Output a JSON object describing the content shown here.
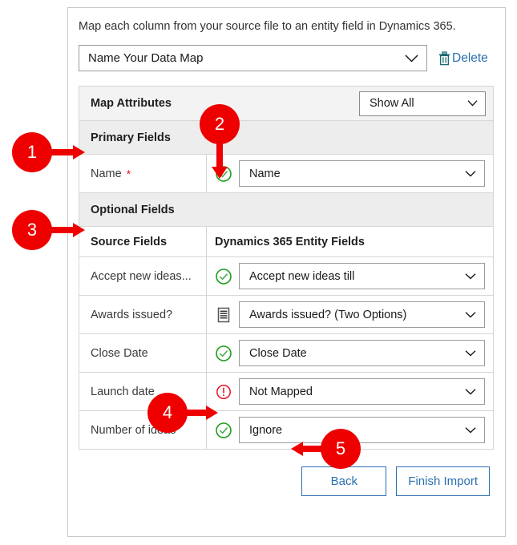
{
  "dialog": {
    "intro": "Map each column from your source file to an entity field in Dynamics 365.",
    "data_map_name": "Name Your Data Map",
    "delete_label": "Delete",
    "delete_icon": "trash-icon",
    "dropdown_icon": "chevron-down-icon"
  },
  "attributes": {
    "header_title": "Map Attributes",
    "filter_value": "Show All",
    "primary_section_label": "Primary Fields",
    "optional_section_label": "Optional Fields",
    "column_headers": {
      "source": "Source Fields",
      "target": "Dynamics 365 Entity Fields"
    },
    "primary_rows": [
      {
        "source": "Name",
        "required": "*",
        "status_icon": "check-circle-icon",
        "status": "mapped",
        "target": "Name"
      }
    ],
    "optional_rows": [
      {
        "source": "Accept new ideas...",
        "status_icon": "check-circle-icon",
        "status": "mapped",
        "target": "Accept new ideas till"
      },
      {
        "source": "Awards issued?",
        "status_icon": "list-document-icon",
        "status": "option-set",
        "target": "Awards issued? (Two Options)"
      },
      {
        "source": "Close Date",
        "status_icon": "check-circle-icon",
        "status": "mapped",
        "target": "Close Date"
      },
      {
        "source": "Launch date",
        "status_icon": "warning-circle-icon",
        "status": "not-mapped",
        "target": "Not Mapped"
      },
      {
        "source": "Number of ideas",
        "status_icon": "check-circle-icon",
        "status": "mapped",
        "target": "Ignore"
      }
    ]
  },
  "footer": {
    "back_label": "Back",
    "finish_label": "Finish Import"
  },
  "annotations": [
    {
      "number": "1",
      "direction": "right"
    },
    {
      "number": "2",
      "direction": "down"
    },
    {
      "number": "3",
      "direction": "right"
    },
    {
      "number": "4",
      "direction": "right"
    },
    {
      "number": "5",
      "direction": "left"
    }
  ],
  "colors": {
    "annotation_red": "#ee0000",
    "link_blue": "#2a6fb0",
    "status_green": "#1d9e1d",
    "status_red": "#e81123",
    "required_star": "#e81123"
  }
}
